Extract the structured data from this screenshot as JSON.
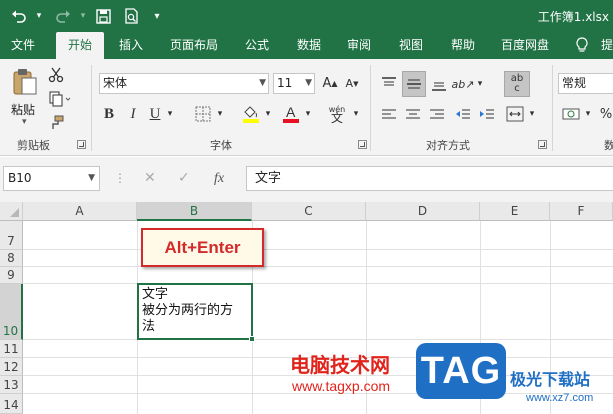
{
  "titlebar": {
    "title": "工作簿1.xlsx",
    "icons": [
      "undo-icon",
      "redo-icon",
      "save-icon",
      "print-preview-icon"
    ]
  },
  "tabs": [
    "文件",
    "开始",
    "插入",
    "页面布局",
    "公式",
    "数据",
    "审阅",
    "视图",
    "帮助",
    "百度网盘",
    "提"
  ],
  "active_tab": "开始",
  "ribbon": {
    "clipboard": {
      "label": "剪贴板",
      "paste": "粘贴"
    },
    "font": {
      "label": "字体",
      "name": "宋体",
      "size": "11",
      "phonetic": "wén"
    },
    "alignment": {
      "label": "对齐方式",
      "wrap_icon": "ab",
      "wrap_sub": "c"
    },
    "number": {
      "format": "常规",
      "label_partial": "数"
    }
  },
  "formula_bar": {
    "namebox": "B10",
    "fx": "fx",
    "content": "文字"
  },
  "grid": {
    "columns": [
      "A",
      "B",
      "C",
      "D",
      "E",
      "F"
    ],
    "selected_column": "B",
    "rows": [
      "7",
      "8",
      "9",
      "10",
      "11",
      "12",
      "13",
      "14"
    ],
    "selected_row": "10",
    "cell_b10": {
      "line1": "文字",
      "line2": "被分为两行的方",
      "line3": "法"
    }
  },
  "callout": "Alt+Enter",
  "watermark": {
    "site_name": "电脑技术网",
    "url": "www.tagxp.com",
    "logo": "TAG",
    "right_text": "极光下载站",
    "right_url": "www.xz7.com"
  },
  "colors": {
    "accent": "#217346",
    "callout_red": "#d42a2a",
    "logo_blue": "#1f6fc4"
  }
}
